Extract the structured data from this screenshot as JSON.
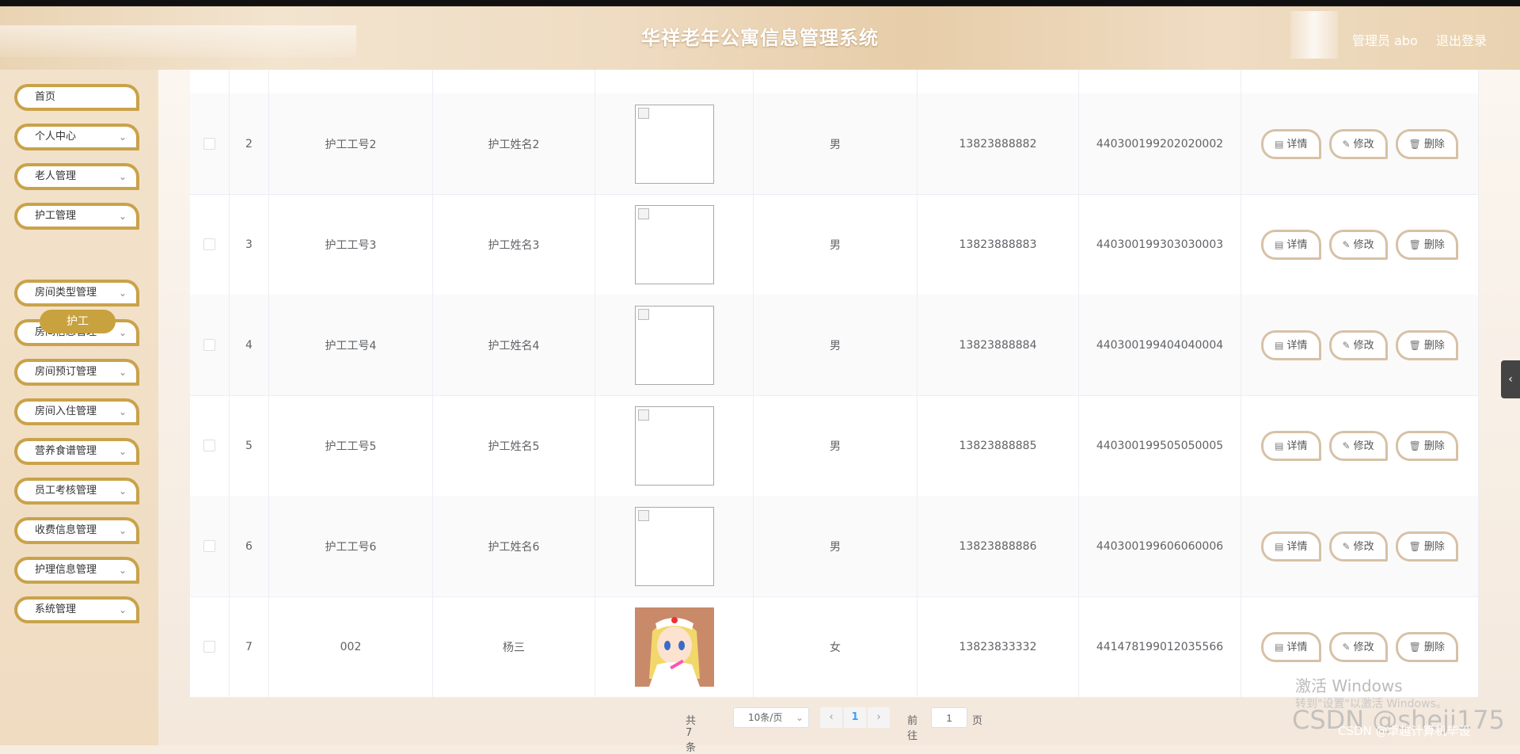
{
  "header": {
    "title": "华祥老年公寓信息管理系统",
    "user_label": "管理员 abo",
    "logout_label": "退出登录"
  },
  "sidebar": {
    "items": [
      {
        "label": "首页",
        "has_chevron": false
      },
      {
        "label": "个人中心",
        "has_chevron": true
      },
      {
        "label": "老人管理",
        "has_chevron": true
      },
      {
        "label": "护工管理",
        "has_chevron": true
      },
      {
        "label": "房间类型管理",
        "has_chevron": true
      },
      {
        "label": "房间信息管理",
        "has_chevron": true
      },
      {
        "label": "房间预订管理",
        "has_chevron": true
      },
      {
        "label": "房间入住管理",
        "has_chevron": true
      },
      {
        "label": "营养食谱管理",
        "has_chevron": true
      },
      {
        "label": "员工考核管理",
        "has_chevron": true
      },
      {
        "label": "收费信息管理",
        "has_chevron": true
      },
      {
        "label": "护理信息管理",
        "has_chevron": true
      },
      {
        "label": "系统管理",
        "has_chevron": true
      }
    ],
    "subitem": "护工"
  },
  "table": {
    "rows": [
      {
        "index": "2",
        "worker_id": "护工工号2",
        "name": "护工姓名2",
        "image": "broken",
        "gender": "男",
        "phone": "13823888882",
        "id_card": "440300199202020002"
      },
      {
        "index": "3",
        "worker_id": "护工工号3",
        "name": "护工姓名3",
        "image": "broken",
        "gender": "男",
        "phone": "13823888883",
        "id_card": "440300199303030003"
      },
      {
        "index": "4",
        "worker_id": "护工工号4",
        "name": "护工姓名4",
        "image": "broken",
        "gender": "男",
        "phone": "13823888884",
        "id_card": "440300199404040004"
      },
      {
        "index": "5",
        "worker_id": "护工工号5",
        "name": "护工姓名5",
        "image": "broken",
        "gender": "男",
        "phone": "13823888885",
        "id_card": "440300199505050005"
      },
      {
        "index": "6",
        "worker_id": "护工工号6",
        "name": "护工姓名6",
        "image": "broken",
        "gender": "男",
        "phone": "13823888886",
        "id_card": "440300199606060006"
      },
      {
        "index": "7",
        "worker_id": "002",
        "name": "杨三",
        "image": "anime-nurse-photo",
        "gender": "女",
        "phone": "13823833332",
        "id_card": "441478199012035566"
      }
    ],
    "actions": {
      "detail": "详情",
      "edit": "修改",
      "delete": "删除"
    }
  },
  "pagination": {
    "total": "共 7 条",
    "page_size": "10条/页",
    "current": "1",
    "goto_label": "前往",
    "goto_value": "1",
    "page_label": "页"
  },
  "watermark": {
    "activate": "激活 Windows",
    "activate_sub": "转到\"设置\"以激活 Windows。",
    "csdn": "CSDN @sheji175",
    "csdn_small": "CSDN @卓越计算机毕设"
  },
  "colors": {
    "accent": "#c8a23e",
    "button_border": "#d7c1a6"
  }
}
